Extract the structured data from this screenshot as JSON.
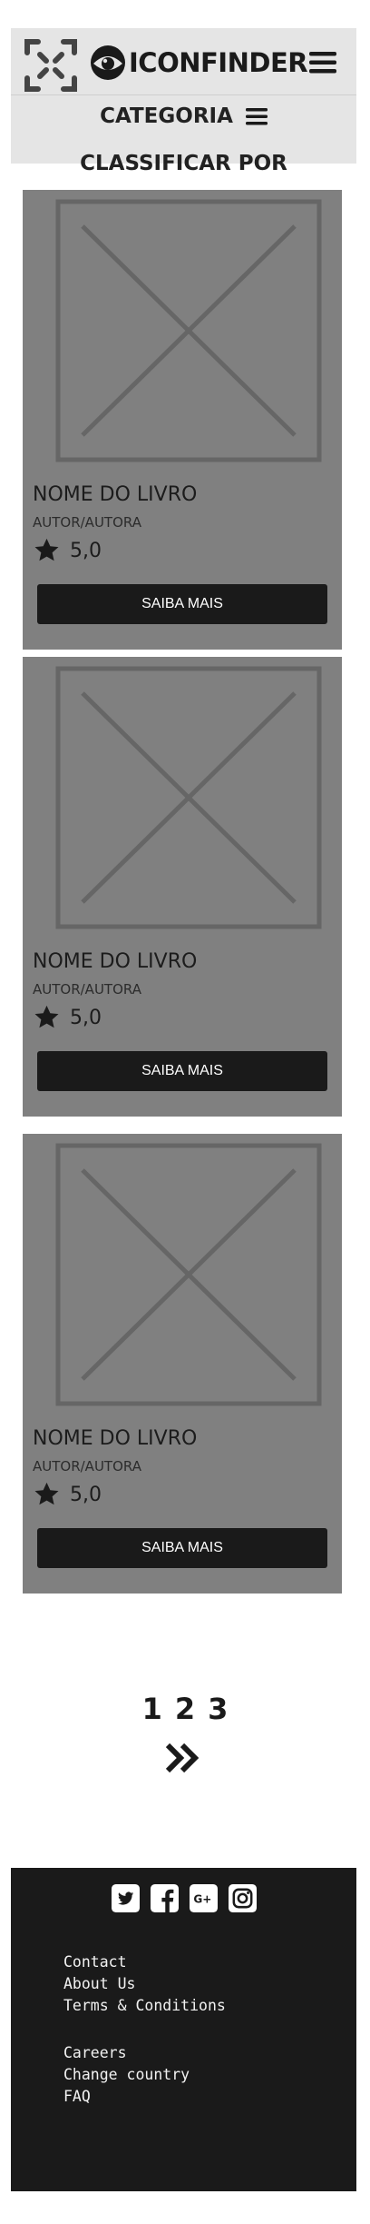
{
  "header": {
    "logo_text": "ICONFINDER",
    "category_label": "CATEGORIA",
    "sort_label": "CLASSIFICAR POR"
  },
  "books": [
    {
      "title": "NOME DO LIVRO",
      "author": "AUTOR/AUTORA",
      "rating": "5,0",
      "button_label": "SAIBA MAIS"
    },
    {
      "title": "NOME DO LIVRO",
      "author": "AUTOR/AUTORA",
      "rating": "5,0",
      "button_label": "SAIBA MAIS"
    },
    {
      "title": "NOME DO LIVRO",
      "author": "AUTOR/AUTORA",
      "rating": "5,0",
      "button_label": "SAIBA MAIS"
    }
  ],
  "pagination": {
    "pages": [
      "1",
      "2",
      "3"
    ],
    "next_icon": "double-chevron-right-icon"
  },
  "footer": {
    "social_icons": [
      "twitter-icon",
      "facebook-icon",
      "google-plus-icon",
      "instagram-icon"
    ],
    "links_group_1": [
      "Contact",
      "About Us",
      "Terms & Conditions"
    ],
    "links_group_2": [
      "Careers",
      "Change country",
      "FAQ"
    ]
  },
  "colors": {
    "header_bg": "#e5e5e5",
    "card_bg": "#808080",
    "button_bg": "#1a1a1a",
    "footer_bg": "#1a1a1a"
  }
}
